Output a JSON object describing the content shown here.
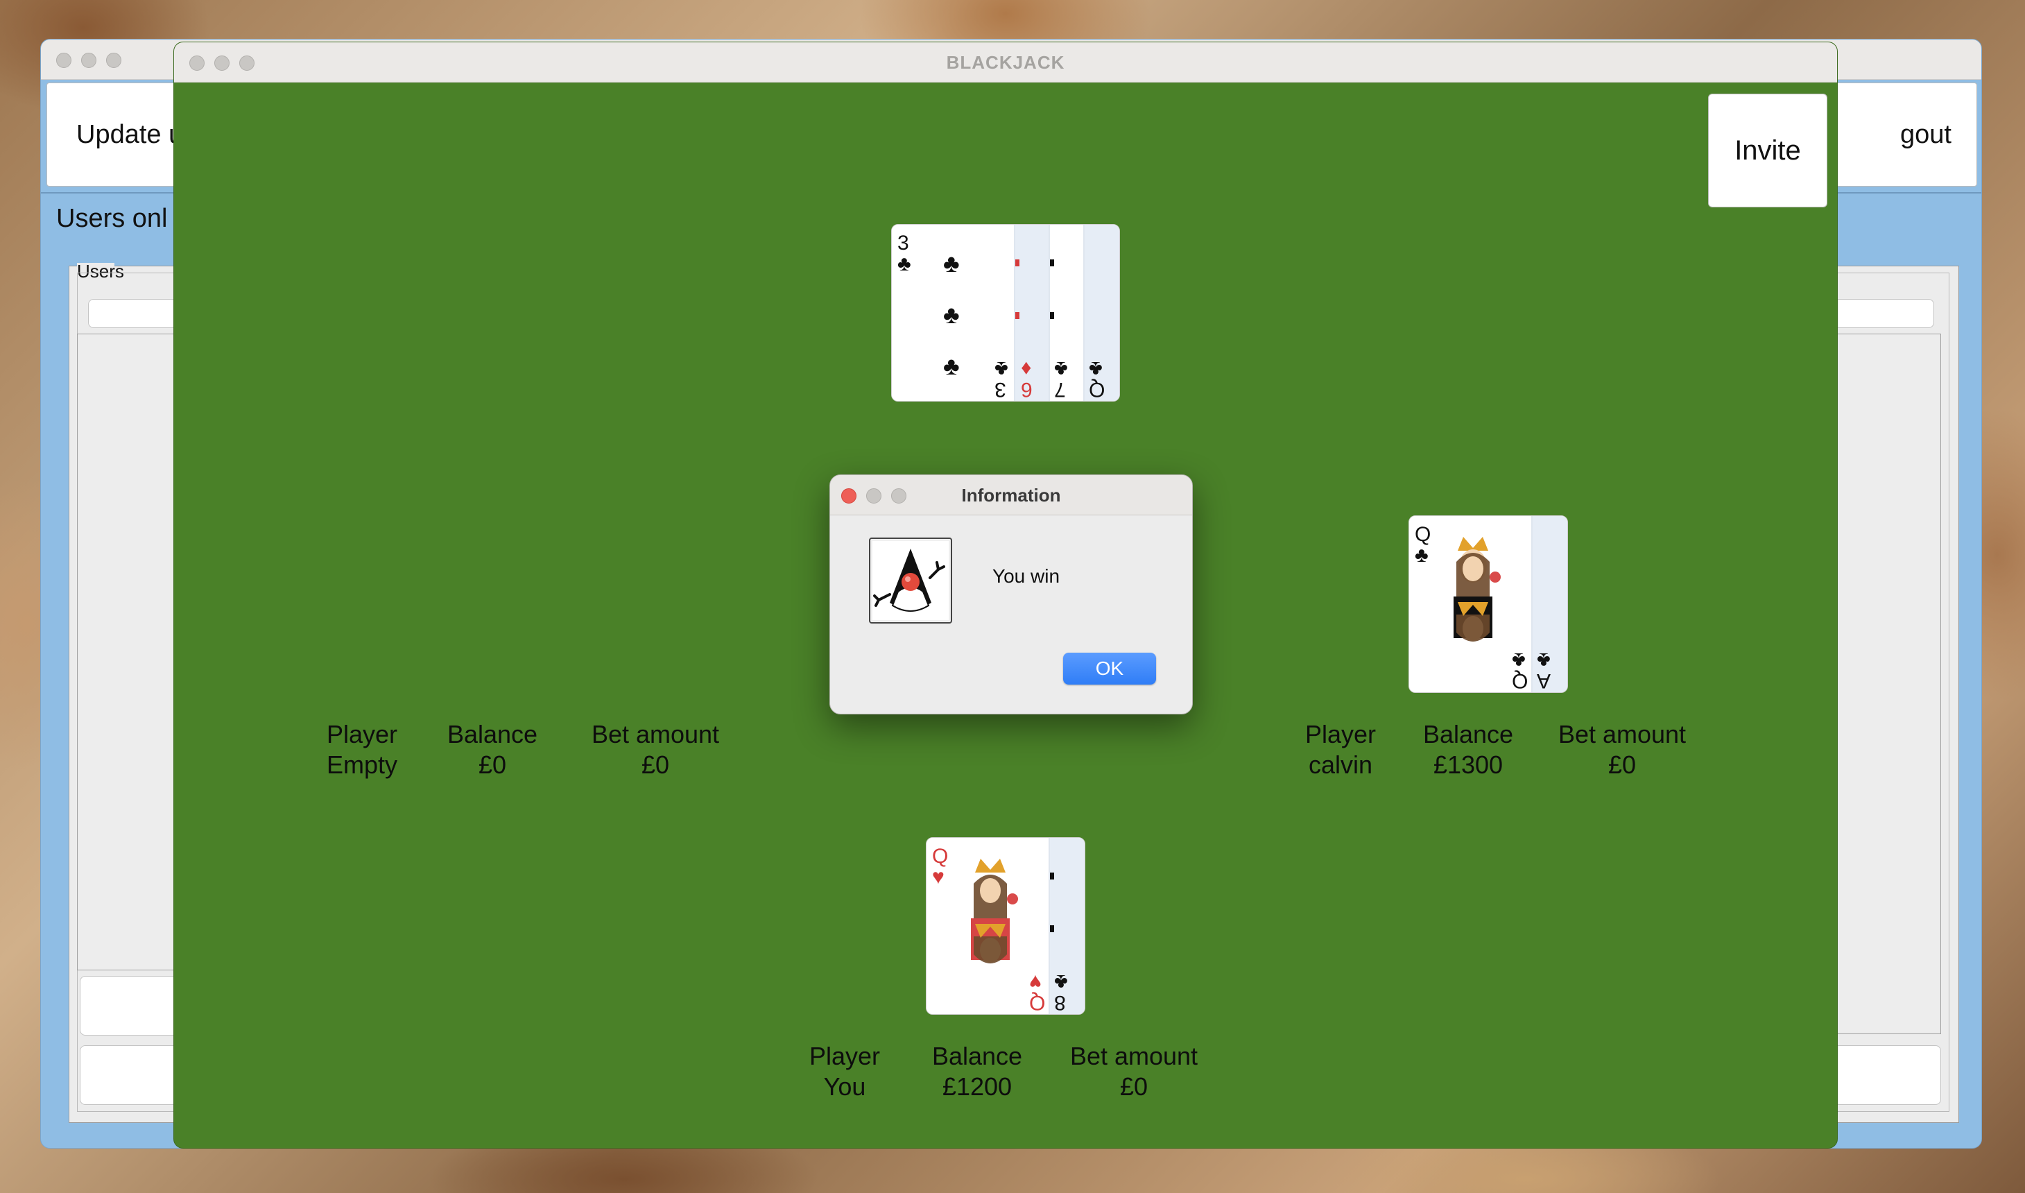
{
  "back_window": {
    "update_button": "Update u",
    "logout_button": "gout",
    "users_online_label": "Users onl",
    "users_panel_title": "Users"
  },
  "game_window": {
    "title": "BLACKJACK",
    "invite_button": "Invite"
  },
  "dealer": {
    "cards": [
      {
        "rank": "3",
        "suit": "♣",
        "color": "#111111"
      },
      {
        "rank": "6",
        "suit": "♦",
        "color": "#d63a3a"
      },
      {
        "rank": "7",
        "suit": "♣",
        "color": "#111111"
      },
      {
        "rank": "Q",
        "suit": "♣",
        "color": "#111111"
      }
    ]
  },
  "seats": {
    "left": {
      "player_heading": "Player",
      "player_name": "Empty",
      "balance_heading": "Balance",
      "balance_value": "£0",
      "bet_heading": "Bet amount",
      "bet_value": "£0"
    },
    "right": {
      "player_heading": "Player",
      "player_name": "calvin",
      "balance_heading": "Balance",
      "balance_value": "£1300",
      "bet_heading": "Bet amount",
      "bet_value": "£0",
      "cards": [
        {
          "rank": "Q",
          "suit": "♣",
          "color": "#111111"
        },
        {
          "rank": "A",
          "suit": "♣",
          "color": "#111111"
        }
      ]
    },
    "bottom": {
      "player_heading": "Player",
      "player_name": "You",
      "balance_heading": "Balance",
      "balance_value": "£1200",
      "bet_heading": "Bet amount",
      "bet_value": "£0",
      "cards": [
        {
          "rank": "Q",
          "suit": "♥",
          "color": "#d63a3a"
        },
        {
          "rank": "8",
          "suit": "♣",
          "color": "#111111"
        }
      ]
    }
  },
  "dialog": {
    "title": "Information",
    "message": "You win",
    "ok_button": "OK",
    "icon": "java-duke-icon",
    "ok_color": "#2f7df6"
  },
  "colors": {
    "table_green": "#4a8128",
    "back_window_blue": "#8fbde4"
  }
}
